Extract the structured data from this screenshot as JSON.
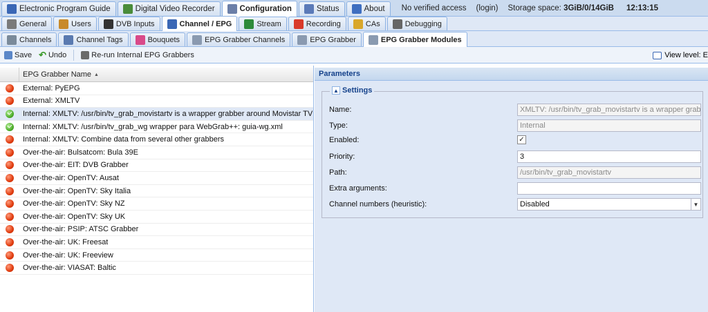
{
  "top_tabs": [
    {
      "label": "Electronic Program Guide",
      "icon": "epg-icon",
      "color": "#3a67b5"
    },
    {
      "label": "Digital Video Recorder",
      "icon": "dvr-icon",
      "color": "#4a8c3a"
    },
    {
      "label": "Configuration",
      "icon": "wrench-icon",
      "color": "#6b7fa8"
    },
    {
      "label": "Status",
      "icon": "eye-icon",
      "color": "#5b7ab8"
    },
    {
      "label": "About",
      "icon": "info-icon",
      "color": "#3f6fc0"
    }
  ],
  "status": {
    "access": "No verified access",
    "login": "(login)",
    "storage_label": "Storage space:",
    "storage_value": "3GiB/0/14GiB",
    "time": "12:13:15"
  },
  "config_tabs": [
    {
      "label": "General",
      "icon": "tools-icon",
      "color": "#7a7a7a"
    },
    {
      "label": "Users",
      "icon": "users-icon",
      "color": "#c88a2a"
    },
    {
      "label": "DVB Inputs",
      "icon": "dvb-icon",
      "color": "#333333"
    },
    {
      "label": "Channel / EPG",
      "icon": "tv-icon",
      "color": "#3a67b5"
    },
    {
      "label": "Stream",
      "icon": "stream-icon",
      "color": "#2e8b3a"
    },
    {
      "label": "Recording",
      "icon": "record-icon",
      "color": "#d93a2a"
    },
    {
      "label": "CAs",
      "icon": "key-icon",
      "color": "#d9a72a"
    },
    {
      "label": "Debugging",
      "icon": "debug-icon",
      "color": "#666666"
    }
  ],
  "channel_tabs": [
    {
      "label": "Channels",
      "icon": "channels-icon",
      "color": "#7a8a9a"
    },
    {
      "label": "Channel Tags",
      "icon": "tags-icon",
      "color": "#5a7ab0"
    },
    {
      "label": "Bouquets",
      "icon": "bouquets-icon",
      "color": "#d94a8a"
    },
    {
      "label": "EPG Grabber Channels",
      "icon": "grabber-channels-icon",
      "color": "#8a9ab0"
    },
    {
      "label": "EPG Grabber",
      "icon": "grabber-icon",
      "color": "#8a9ab0"
    },
    {
      "label": "EPG Grabber Modules",
      "icon": "modules-icon",
      "color": "#8a9ab0"
    }
  ],
  "toolbar": {
    "save": "Save",
    "undo": "Undo",
    "rerun": "Re-run Internal EPG Grabbers",
    "view_level": "View level: E"
  },
  "grid": {
    "header": "EPG Grabber Name",
    "rows": [
      {
        "name": "External: PyEPG",
        "enabled": false
      },
      {
        "name": "External: XMLTV",
        "enabled": false
      },
      {
        "name": "Internal: XMLTV: /usr/bin/tv_grab_movistartv is a wrapper grabber around Movistar TV",
        "enabled": true,
        "selected": true
      },
      {
        "name": "Internal: XMLTV: /usr/bin/tv_grab_wg wrapper para WebGrab++: guia-wg.xml",
        "enabled": true
      },
      {
        "name": "Internal: XMLTV: Combine data from several other grabbers",
        "enabled": false
      },
      {
        "name": "Over-the-air: Bulsatcom: Bula 39E",
        "enabled": false
      },
      {
        "name": "Over-the-air: EIT: DVB Grabber",
        "enabled": false
      },
      {
        "name": "Over-the-air: OpenTV: Ausat",
        "enabled": false
      },
      {
        "name": "Over-the-air: OpenTV: Sky Italia",
        "enabled": false
      },
      {
        "name": "Over-the-air: OpenTV: Sky NZ",
        "enabled": false
      },
      {
        "name": "Over-the-air: OpenTV: Sky UK",
        "enabled": false
      },
      {
        "name": "Over-the-air: PSIP: ATSC Grabber",
        "enabled": false
      },
      {
        "name": "Over-the-air: UK: Freesat",
        "enabled": false
      },
      {
        "name": "Over-the-air: UK: Freeview",
        "enabled": false
      },
      {
        "name": "Over-the-air: VIASAT: Baltic",
        "enabled": false
      }
    ]
  },
  "params": {
    "title": "Parameters",
    "settings_legend": "Settings",
    "name_label": "Name:",
    "name_value": "XMLTV: /usr/bin/tv_grab_movistartv is a wrapper grabber around Movistar TV",
    "type_label": "Type:",
    "type_value": "Internal",
    "enabled_label": "Enabled:",
    "enabled_value": "✓",
    "priority_label": "Priority:",
    "priority_value": "3",
    "path_label": "Path:",
    "path_value": "/usr/bin/tv_grab_movistartv",
    "extra_label": "Extra arguments:",
    "extra_value": "",
    "chnum_label": "Channel numbers (heuristic):",
    "chnum_value": "Disabled"
  }
}
